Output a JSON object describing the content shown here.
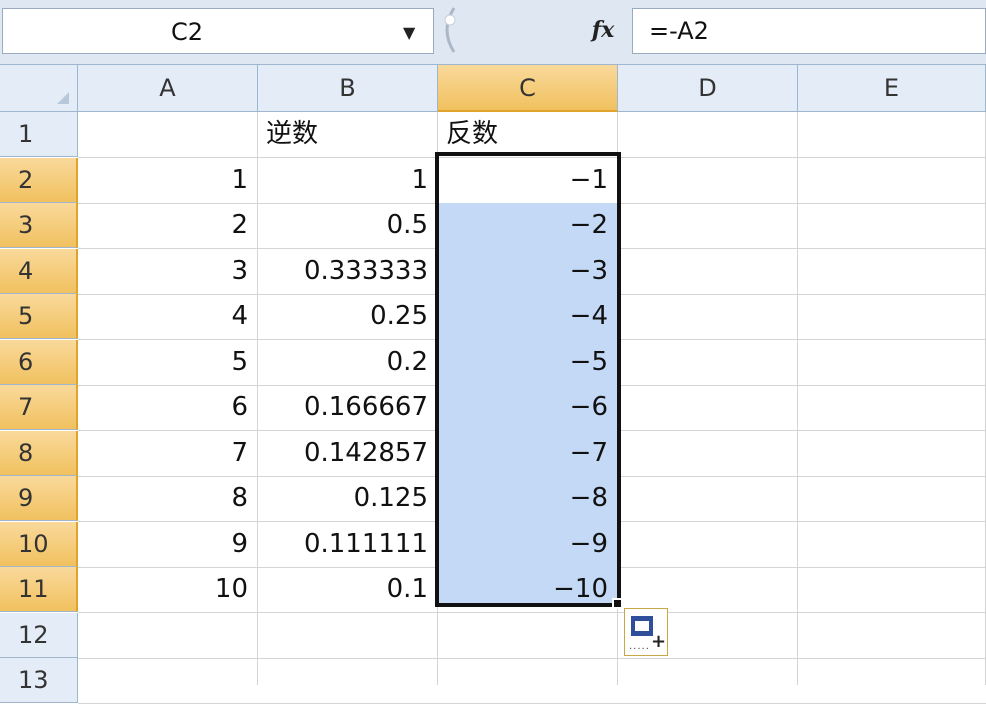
{
  "formula_bar": {
    "name_box": "C2",
    "dropdown_icon": "chevron-down-icon",
    "fx_label": "fx",
    "formula": "=-A2"
  },
  "columns": [
    "A",
    "B",
    "C",
    "D",
    "E"
  ],
  "active_column": "C",
  "rows": [
    {
      "num": "1",
      "a": "",
      "b": "逆数",
      "c": "反数"
    },
    {
      "num": "2",
      "a": "1",
      "b": "1",
      "c": "−1"
    },
    {
      "num": "3",
      "a": "2",
      "b": "0.5",
      "c": "−2"
    },
    {
      "num": "4",
      "a": "3",
      "b": "0.333333",
      "c": "−3"
    },
    {
      "num": "5",
      "a": "4",
      "b": "0.25",
      "c": "−4"
    },
    {
      "num": "6",
      "a": "5",
      "b": "0.2",
      "c": "−5"
    },
    {
      "num": "7",
      "a": "6",
      "b": "0.166667",
      "c": "−6"
    },
    {
      "num": "8",
      "a": "7",
      "b": "0.142857",
      "c": "−7"
    },
    {
      "num": "9",
      "a": "8",
      "b": "0.125",
      "c": "−8"
    },
    {
      "num": "10",
      "a": "9",
      "b": "0.111111",
      "c": "−9"
    },
    {
      "num": "11",
      "a": "10",
      "b": "0.1",
      "c": "−10"
    },
    {
      "num": "12",
      "a": "",
      "b": "",
      "c": ""
    },
    {
      "num": "13",
      "a": "",
      "b": "",
      "c": ""
    }
  ],
  "active_rows": [
    "2",
    "3",
    "4",
    "5",
    "6",
    "7",
    "8",
    "9",
    "10",
    "11"
  ],
  "selection": "C2:C11",
  "colors": {
    "header_bg": "#e4ecf7",
    "active_header": "#f1c15f",
    "selection_fill": "#c3d9f5"
  }
}
